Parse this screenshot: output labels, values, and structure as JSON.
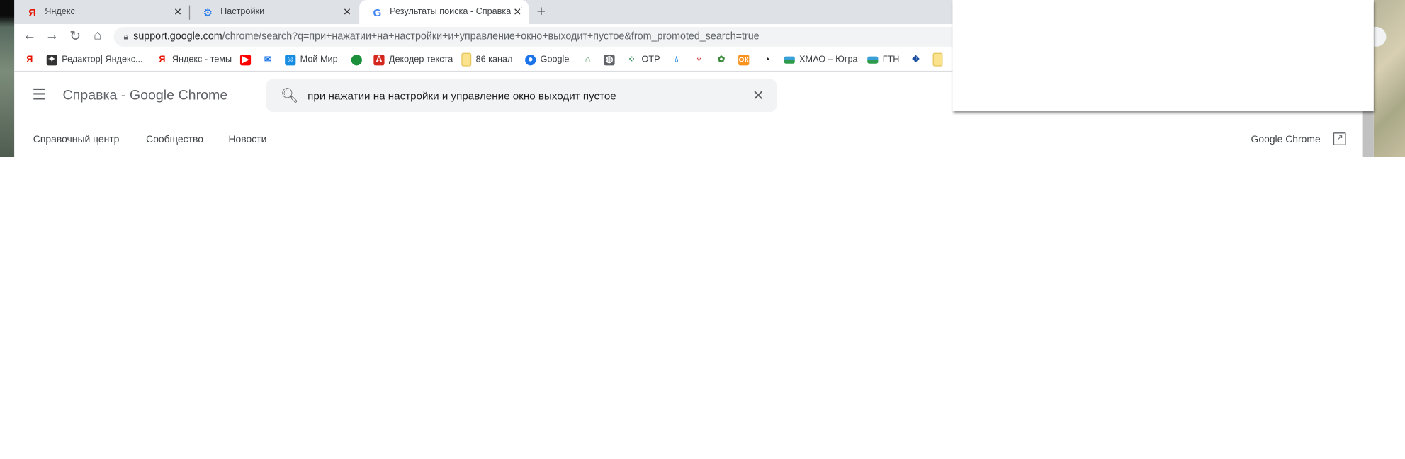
{
  "tabs": [
    {
      "title": "Яндекс",
      "icon": "yandex-icon",
      "active": false
    },
    {
      "title": "Настройки",
      "icon": "gear-icon",
      "active": false
    },
    {
      "title": "Результаты поиска - Справка - (",
      "icon": "google-icon",
      "active": true
    }
  ],
  "new_tab": "+",
  "close_glyph": "✕",
  "address": {
    "host": "support.google.com",
    "path": "/chrome/search?q=при+нажатии+на+настройки+и+управление+окно+выходит+пустое&from_promoted_search=true"
  },
  "bookmarks": [
    {
      "label": "",
      "icon": "yandex-icon"
    },
    {
      "label": "Редактор| Яндекс...",
      "icon": "zen-icon"
    },
    {
      "label": "Яндекс - темы",
      "icon": "yandex-icon"
    },
    {
      "label": "",
      "icon": "youtube-icon"
    },
    {
      "label": "",
      "icon": "mail-icon"
    },
    {
      "label": "Мой Мир",
      "icon": "moimir-icon"
    },
    {
      "label": "",
      "icon": "green-circle-icon"
    },
    {
      "label": "Декодер текста",
      "icon": "als-icon"
    },
    {
      "label": "86 канал",
      "icon": "folder-icon"
    },
    {
      "label": "Google",
      "icon": "account-icon"
    },
    {
      "label": "",
      "icon": "portrait-icon"
    },
    {
      "label": "",
      "icon": "globe-icon"
    },
    {
      "label": "OTP",
      "icon": "otp-icon"
    },
    {
      "label": "",
      "icon": "drop-icon"
    },
    {
      "label": "",
      "icon": "red-emblem-icon"
    },
    {
      "label": "",
      "icon": "bug-icon"
    },
    {
      "label": "",
      "icon": "odnoklassniki-icon"
    },
    {
      "label": "",
      "icon": "speedometer-icon"
    },
    {
      "label": "ХМАО – Югра",
      "icon": "flag-icon"
    },
    {
      "label": "ГТН",
      "icon": "flag-icon"
    },
    {
      "label": "",
      "icon": "eagle-emblem-icon"
    },
    {
      "label": "",
      "icon": "folder-icon"
    }
  ],
  "header": {
    "title": "Справка - Google Chrome",
    "search_value": "при нажатии на настройки и управление окно выходит пустое"
  },
  "nav": [
    "Справочный центр",
    "Сообщество",
    "Новости"
  ],
  "product_link": "Google Chrome"
}
